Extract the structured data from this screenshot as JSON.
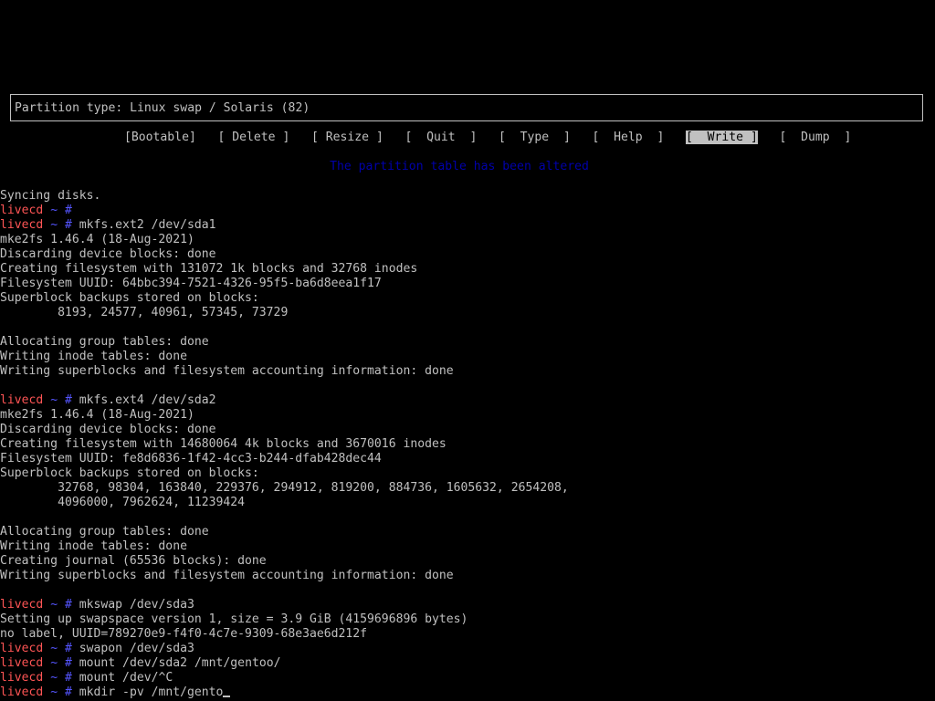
{
  "partition_type_label": "Partition type: Linux swap / Solaris (82)",
  "menu": {
    "items": [
      {
        "label": "[Bootable]",
        "selected": false
      },
      {
        "label": "[ Delete ]",
        "selected": false
      },
      {
        "label": "[ Resize ]",
        "selected": false
      },
      {
        "label": "[  Quit  ]",
        "selected": false
      },
      {
        "label": "[  Type  ]",
        "selected": false
      },
      {
        "label": "[  Help  ]",
        "selected": false
      },
      {
        "label": "[  Write ]",
        "selected": true
      },
      {
        "label": "[  Dump  ]",
        "selected": false
      }
    ]
  },
  "status_message": "The partition table has been altered",
  "prompt": {
    "host": "livecd",
    "path": "~",
    "symbol": "#"
  },
  "console_lines": [
    {
      "type": "output",
      "text": "Syncing disks."
    },
    {
      "type": "prompt",
      "text": ""
    },
    {
      "type": "prompt",
      "text": "mkfs.ext2 /dev/sda1"
    },
    {
      "type": "output",
      "text": "mke2fs 1.46.4 (18-Aug-2021)"
    },
    {
      "type": "output",
      "text": "Discarding device blocks: done"
    },
    {
      "type": "output",
      "text": "Creating filesystem with 131072 1k blocks and 32768 inodes"
    },
    {
      "type": "output",
      "text": "Filesystem UUID: 64bbc394-7521-4326-95f5-ba6d8eea1f17"
    },
    {
      "type": "output",
      "text": "Superblock backups stored on blocks:"
    },
    {
      "type": "output",
      "text": "        8193, 24577, 40961, 57345, 73729"
    },
    {
      "type": "output",
      "text": ""
    },
    {
      "type": "output",
      "text": "Allocating group tables: done"
    },
    {
      "type": "output",
      "text": "Writing inode tables: done"
    },
    {
      "type": "output",
      "text": "Writing superblocks and filesystem accounting information: done"
    },
    {
      "type": "output",
      "text": ""
    },
    {
      "type": "prompt",
      "text": "mkfs.ext4 /dev/sda2"
    },
    {
      "type": "output",
      "text": "mke2fs 1.46.4 (18-Aug-2021)"
    },
    {
      "type": "output",
      "text": "Discarding device blocks: done"
    },
    {
      "type": "output",
      "text": "Creating filesystem with 14680064 4k blocks and 3670016 inodes"
    },
    {
      "type": "output",
      "text": "Filesystem UUID: fe8d6836-1f42-4cc3-b244-dfab428dec44"
    },
    {
      "type": "output",
      "text": "Superblock backups stored on blocks:"
    },
    {
      "type": "output",
      "text": "        32768, 98304, 163840, 229376, 294912, 819200, 884736, 1605632, 2654208,"
    },
    {
      "type": "output",
      "text": "        4096000, 7962624, 11239424"
    },
    {
      "type": "output",
      "text": ""
    },
    {
      "type": "output",
      "text": "Allocating group tables: done"
    },
    {
      "type": "output",
      "text": "Writing inode tables: done"
    },
    {
      "type": "output",
      "text": "Creating journal (65536 blocks): done"
    },
    {
      "type": "output",
      "text": "Writing superblocks and filesystem accounting information: done"
    },
    {
      "type": "output",
      "text": ""
    },
    {
      "type": "prompt",
      "text": "mkswap /dev/sda3"
    },
    {
      "type": "output",
      "text": "Setting up swapspace version 1, size = 3.9 GiB (4159696896 bytes)"
    },
    {
      "type": "output",
      "text": "no label, UUID=789270e9-f4f0-4c7e-9309-68e3ae6d212f"
    },
    {
      "type": "prompt",
      "text": "swapon /dev/sda3"
    },
    {
      "type": "prompt",
      "text": "mount /dev/sda2 /mnt/gentoo/"
    },
    {
      "type": "prompt",
      "text": "mount /dev/^C"
    },
    {
      "type": "prompt",
      "text": "mkdir -pv /mnt/gento",
      "cursor": true
    }
  ],
  "colors": {
    "background": "#000000",
    "foreground": "#c0c0c0",
    "prompt_host": "#ff5555",
    "prompt_path": "#5555ff",
    "status_message": "#0000aa"
  }
}
